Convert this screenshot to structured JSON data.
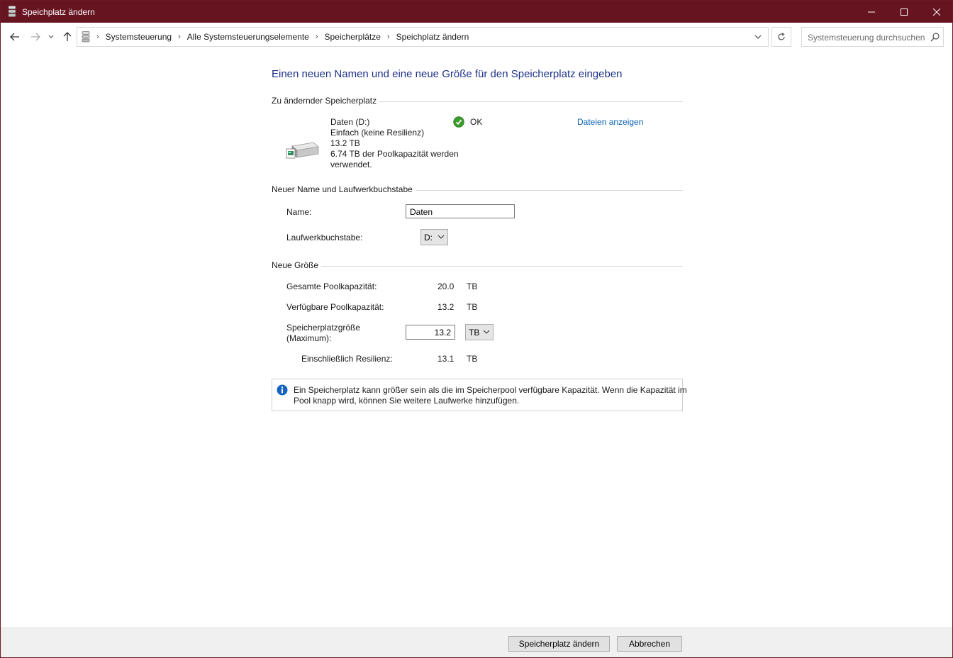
{
  "window": {
    "title": "Speichplatz ändern"
  },
  "address": {
    "crumbs": [
      "Systemsteuerung",
      "Alle Systemsteuerungselemente",
      "Speicherplätze",
      "Speichplatz ändern"
    ],
    "search_placeholder": "Systemsteuerung durchsuchen"
  },
  "page": {
    "heading": "Einen neuen Namen und eine neue Größe für den Speicherplatz eingeben",
    "space_section": "Zu ändernder Speicherplatz",
    "space": {
      "name": "Daten (D:)",
      "type": "Einfach (keine Resilienz)",
      "size": "13.2 TB",
      "usage_line1": "6.74 TB der Poolkapazität werden",
      "usage_line2": "verwendet.",
      "status": "OK",
      "show_files_link": "Dateien anzeigen"
    },
    "name_section": "Neuer Name und Laufwerkbuchstabe",
    "name_label": "Name:",
    "name_value": "Daten",
    "drive_letter_label": "Laufwerkbuchstabe:",
    "drive_letter_value": "D:",
    "size_section": "Neue Größe",
    "total_pool_label": "Gesamte Poolkapazität:",
    "total_pool_value": "20.0",
    "total_pool_unit": "TB",
    "available_pool_label": "Verfügbare Poolkapazität:",
    "available_pool_value": "13.2",
    "available_pool_unit": "TB",
    "space_size_label_line1": "Speicherplatzgröße",
    "space_size_label_line2": "(Maximum):",
    "space_size_value": "13.2",
    "space_size_unit": "TB",
    "resilience_label": "Einschließlich Resilienz:",
    "resilience_value": "13.1",
    "resilience_unit": "TB",
    "info_line1": "Ein Speicherplatz kann größer sein als die im Speicherpool verfügbare Kapazität. Wenn die Kapazität im",
    "info_line2": "Pool knapp wird, können Sie weitere Laufwerke hinzufügen."
  },
  "footer": {
    "primary_button": "Speicherplatz ändern",
    "cancel_button": "Abbrechen"
  },
  "colors": {
    "titlebar": "#651420",
    "heading": "#1e3287",
    "link": "#0a62b0",
    "ok": "#3d9a2c",
    "info": "#1565c0"
  }
}
